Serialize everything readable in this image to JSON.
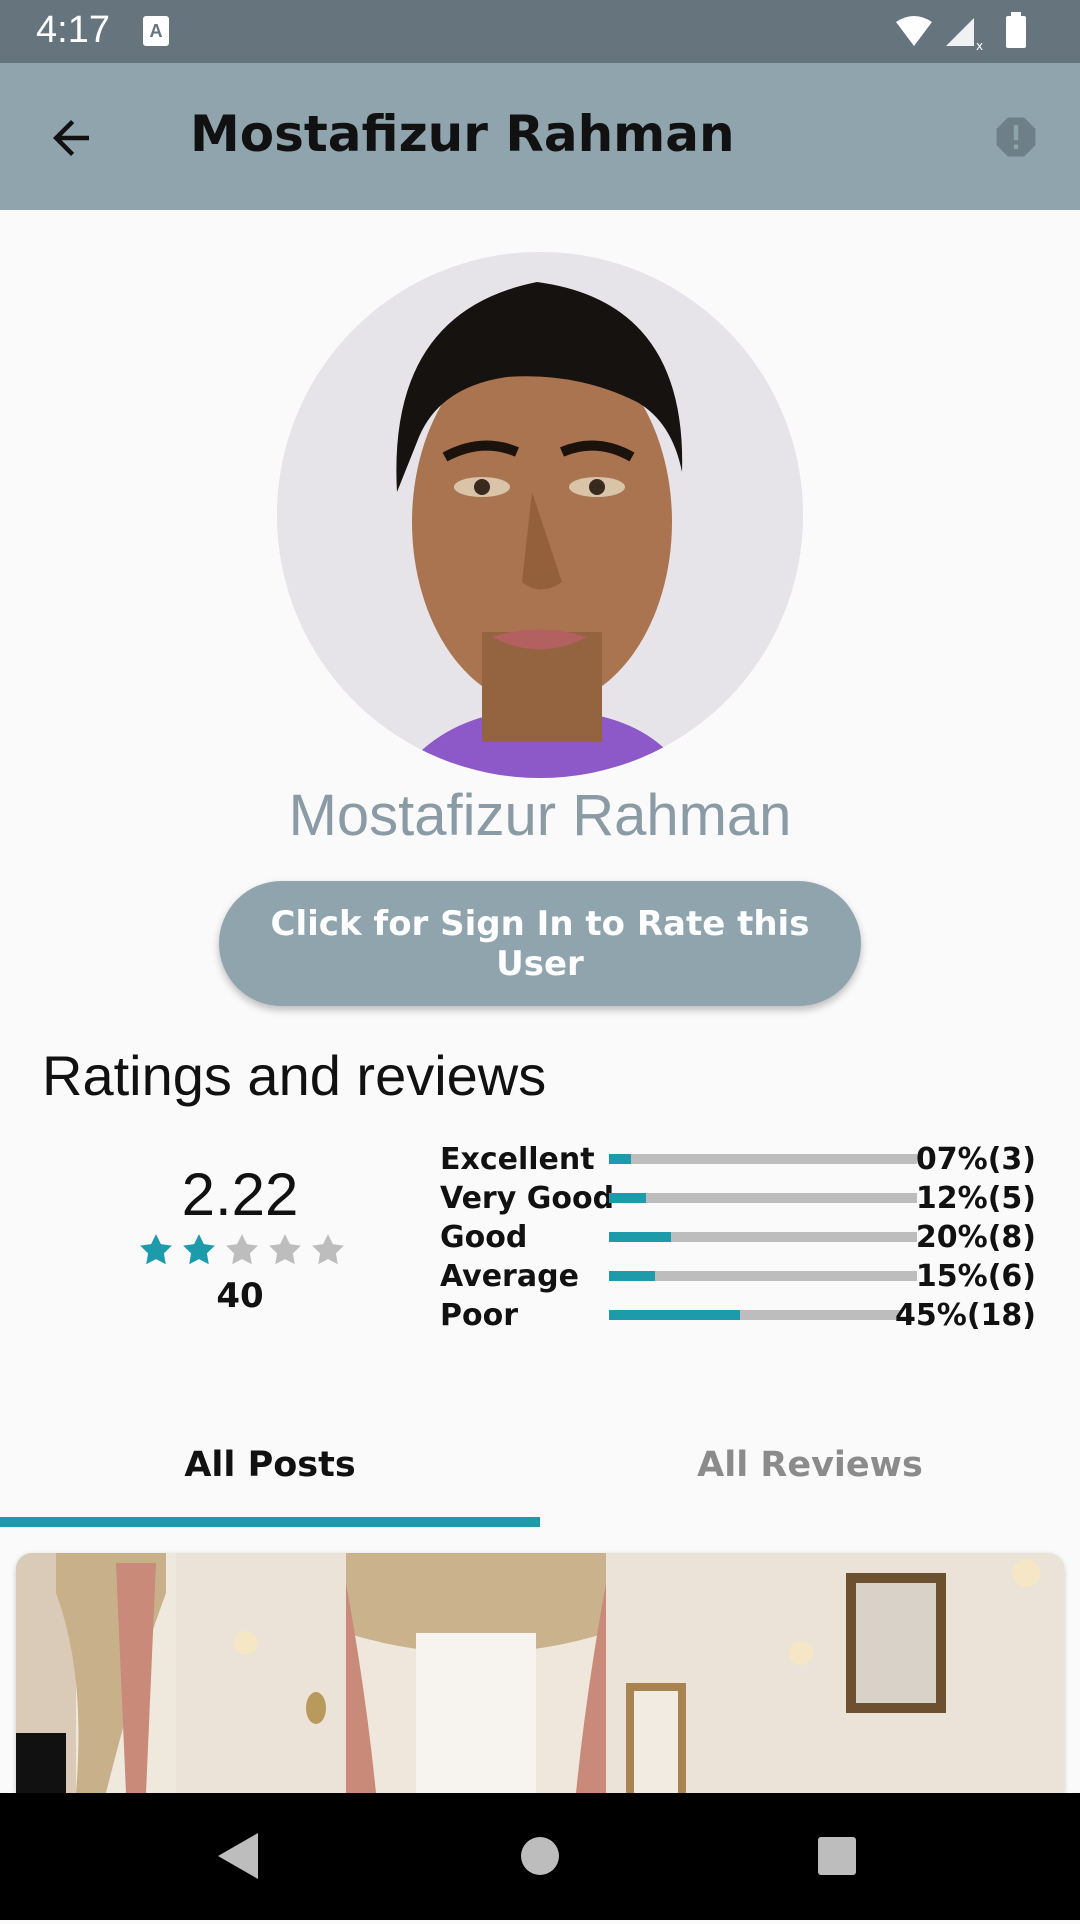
{
  "status_bar": {
    "time": "4:17",
    "notification_icon": "A"
  },
  "app_bar": {
    "title": "Mostafizur Rahman"
  },
  "profile": {
    "name": "Mostafizur Rahman",
    "sign_in_button": "Click for Sign In to Rate this User"
  },
  "ratings": {
    "section_title": "Ratings and reviews",
    "average": "2.22",
    "stars_filled": 2,
    "stars_total": 5,
    "total_count": "40",
    "accent_color": "#1e9bab",
    "rows": [
      {
        "label": "Excellent",
        "percent_text": "07%(3)",
        "fraction": 0.07
      },
      {
        "label": "Very Good",
        "percent_text": "12%(5)",
        "fraction": 0.12
      },
      {
        "label": "Good",
        "percent_text": "20%(8)",
        "fraction": 0.2
      },
      {
        "label": "Average",
        "percent_text": "15%(6)",
        "fraction": 0.15
      },
      {
        "label": "Poor",
        "percent_text": "45%(18)",
        "fraction": 0.45
      }
    ]
  },
  "tabs": [
    {
      "label": "All Posts",
      "active": true
    },
    {
      "label": "All Reviews",
      "active": false
    }
  ]
}
